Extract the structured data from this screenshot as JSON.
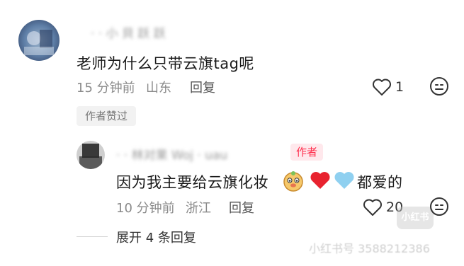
{
  "main_comment": {
    "avatar_icon": "user-avatar",
    "username": "· · 小 貝 跃 跃",
    "text": "老师为什么只带云旗tag呢",
    "time": "15 分钟前",
    "location": "山东",
    "reply_label": "回复",
    "like_count": "1",
    "author_liked_badge": "作者赞过"
  },
  "reply_comment": {
    "avatar_icon": "user-avatar",
    "username": "· · 林对果 Woj · uau",
    "author_tag": "作者",
    "text": "因为我主要给云旗化妆",
    "emojis": [
      "face-emoji",
      "red-heart",
      "blue-heart"
    ],
    "text_suffix": "都爱的",
    "time": "10 分钟前",
    "location": "浙江",
    "reply_label": "回复",
    "like_count": "20"
  },
  "expand": {
    "label": "展开 4 条回复"
  },
  "watermark": {
    "logo_text": "小红书",
    "id_text": "小红书号 3588212386"
  },
  "colors": {
    "heart_red": "#e8232f",
    "heart_blue": "#8fd0f0",
    "author_tag_red": "#ff2e4d"
  }
}
